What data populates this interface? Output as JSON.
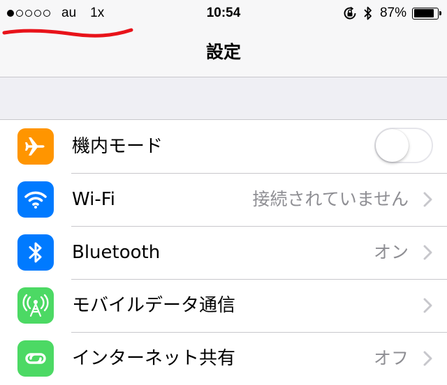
{
  "status_bar": {
    "signal_icon": "signal-dots",
    "signal_bars_filled": 1,
    "signal_bars_total": 5,
    "carrier": "au",
    "network": "1x",
    "time": "10:54",
    "battery_percent": "87%",
    "battery_level": 0.87
  },
  "nav": {
    "title": "設定"
  },
  "colors": {
    "airplane": "#ff9500",
    "wifi": "#007aff",
    "bluetooth": "#007aff",
    "cellular": "#4cd964",
    "hotspot": "#4cd964",
    "annotation_stroke": "#e8131a"
  },
  "settings": {
    "rows": [
      {
        "label": "機内モード",
        "icon": "airplane-icon",
        "control": "toggle",
        "toggle_on": false
      },
      {
        "label": "Wi-Fi",
        "icon": "wifi-icon",
        "value": "接続されていません"
      },
      {
        "label": "Bluetooth",
        "icon": "bluetooth-icon",
        "value": "オン"
      },
      {
        "label": "モバイルデータ通信",
        "icon": "cellular-antenna-icon",
        "value": ""
      },
      {
        "label": "インターネット共有",
        "icon": "personal-hotspot-icon",
        "value": "オフ"
      }
    ]
  }
}
